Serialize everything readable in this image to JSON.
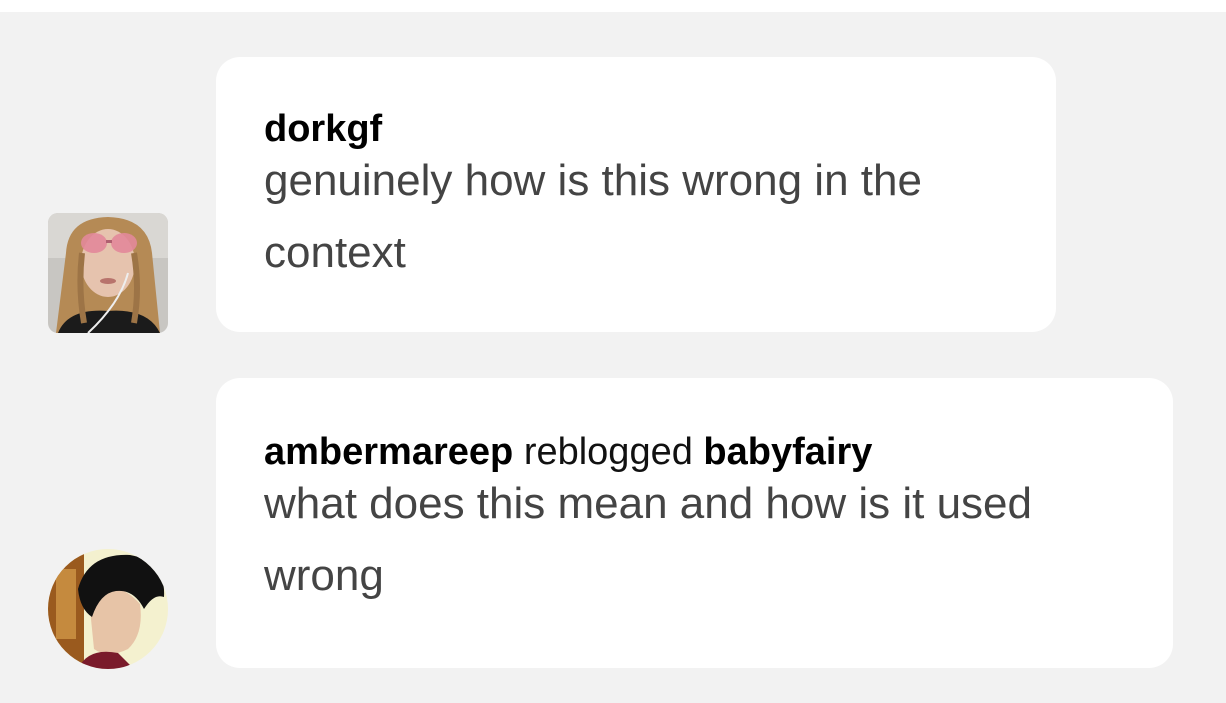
{
  "notes": [
    {
      "avatar": "avatar-woman-pink-sunglasses",
      "username": "dorkgf",
      "text": "genuinely how is this wrong in the context"
    },
    {
      "avatar": "avatar-short-dark-hair",
      "username": "ambermareep",
      "action": "reblogged",
      "target": "babyfairy",
      "text": "what does this mean and how is it used wrong"
    }
  ],
  "colors": {
    "background": "#f2f2f2",
    "bubble": "#ffffff",
    "username": "#000000",
    "body_text": "#444444"
  }
}
